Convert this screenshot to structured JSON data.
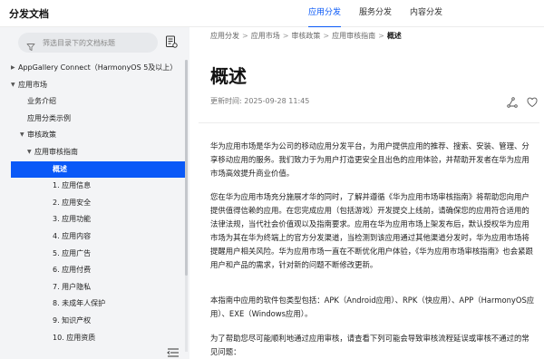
{
  "header": {
    "brand": "分发文档",
    "nav": [
      {
        "label": "应用分发",
        "active": true
      },
      {
        "label": "服务分发",
        "active": false
      },
      {
        "label": "内容分发",
        "active": false
      }
    ]
  },
  "sidebar": {
    "search_placeholder": "筛选目录下的文档标题",
    "tree": [
      {
        "label": "AppGallery Connect（HarmonyOS 5及以上）",
        "level": 0,
        "caret": "right"
      },
      {
        "label": "应用市场",
        "level": 0,
        "caret": "down"
      },
      {
        "label": "业务介绍",
        "level": 1,
        "caret": ""
      },
      {
        "label": "应用分类示例",
        "level": 1,
        "caret": ""
      },
      {
        "label": "审核政策",
        "level": 1,
        "caret": "down"
      },
      {
        "label": "应用审核指南",
        "level": 2,
        "caret": "down"
      },
      {
        "label": "概述",
        "level": 3,
        "caret": "",
        "active": true
      },
      {
        "label": "1. 应用信息",
        "level": 3,
        "caret": ""
      },
      {
        "label": "2. 应用安全",
        "level": 3,
        "caret": ""
      },
      {
        "label": "3. 应用功能",
        "level": 3,
        "caret": ""
      },
      {
        "label": "4. 应用内容",
        "level": 3,
        "caret": ""
      },
      {
        "label": "5. 应用广告",
        "level": 3,
        "caret": ""
      },
      {
        "label": "6. 应用付费",
        "level": 3,
        "caret": ""
      },
      {
        "label": "7. 用户隐私",
        "level": 3,
        "caret": ""
      },
      {
        "label": "8. 未成年人保护",
        "level": 3,
        "caret": ""
      },
      {
        "label": "9. 知识产权",
        "level": 3,
        "caret": ""
      },
      {
        "label": "10. 应用资质",
        "level": 3,
        "caret": ""
      }
    ]
  },
  "content": {
    "breadcrumb": [
      "应用分发",
      "应用市场",
      "审核政策",
      "应用审核指南",
      "概述"
    ],
    "title": "概述",
    "updated": "更新时间: 2025-09-28 11:45",
    "paragraphs": [
      "华为应用市场是华为公司的移动应用分发平台，为用户提供应用的推荐、搜索、安装、管理、分享移动应用的服务。我们致力于为用户打造更安全且出色的应用体验，并帮助开发者在华为应用市场高效提升商业价值。",
      "您在华为应用市场充分施展才华的同时，了解并遵循《华为应用市场审核指南》将帮助您向用户提供值得信赖的应用。在您完成应用（包括游戏）开发提交上线前，请确保您的应用符合适用的法律法规，当代社会价值观以及指南要求。应用在华为应用市场上架发布后，默认授权华为应用市场为其在华为终端上的官方分发渠道，当检测到该应用通过其他渠道分发时，华为应用市场将提醒用户相关风险。华为应用市场一直在不断优化用户体验，《华为应用市场审核指南》也会紧跟用户和产品的需求，针对新的问题不断修改更新。",
      "本指南中应用的软件包类型包括：APK（Android应用）、RPK（快应用）、APP（HarmonyOS应用）、EXE（Windows应用）。",
      "为了帮助您尽可能顺利地通过应用审核，请查看下列可能会导致审核流程延误或审核不通过的常见问题："
    ]
  },
  "colors": {
    "accent": "#0a59f7",
    "sidebar_bg": "#f3f4f6"
  },
  "icons": [
    "filter-icon",
    "toc-icon",
    "share-icon",
    "like-icon",
    "collapse-icon",
    "caret-right-icon",
    "caret-down-icon"
  ]
}
